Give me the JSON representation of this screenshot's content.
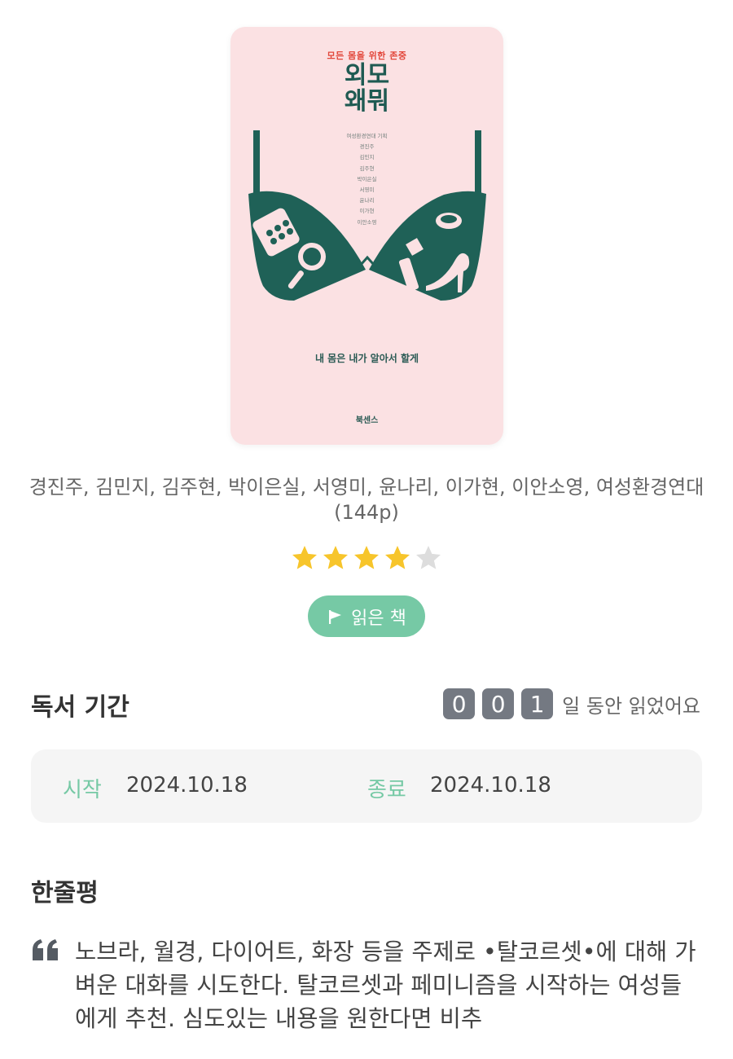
{
  "book": {
    "cover": {
      "subtitle": "모든 몸을 위한 존중",
      "title_line1": "외모",
      "title_line2": "왜뭐",
      "credits": [
        "여성환경연대 기획",
        "경진주",
        "김민지",
        "김주현",
        "박이은실",
        "서영미",
        "윤나리",
        "이가현",
        "이안소영"
      ],
      "tagline": "내 몸은 내가 알아서 할게",
      "publisher": "북센스",
      "colors": {
        "background": "#fbe1e3",
        "art": "#1f6157",
        "title": "#1f5a52",
        "subtitle": "#e2463a"
      }
    },
    "authors": "경진주, 김민지, 김주현, 박이은실, 서영미, 윤나리, 이가현, 이안소영, 여성환경연대 (144p)",
    "rating": {
      "value": 4,
      "max": 5,
      "filled_color": "#f7c52b",
      "empty_color": "#dddddd"
    },
    "status": {
      "label": "읽은 책",
      "icon": "flag-icon",
      "color": "#76c9a5"
    }
  },
  "reading_period": {
    "title": "독서 기간",
    "days_digits": [
      "0",
      "0",
      "1"
    ],
    "days_suffix": "일 동안 읽었어요",
    "start_label": "시작",
    "start_date": "2024.10.18",
    "end_label": "종료",
    "end_date": "2024.10.18",
    "accent": "#76c9a5"
  },
  "review": {
    "title": "한줄평",
    "icon": "quote-icon",
    "text": "노브라, 월경, 다이어트, 화장 등을 주제로 •탈코르셋•에 대해 가벼운 대화를 시도한다. 탈코르셋과 페미니즘을 시작하는 여성들에게 추천. 심도있는 내용을 원한다면 비추"
  }
}
